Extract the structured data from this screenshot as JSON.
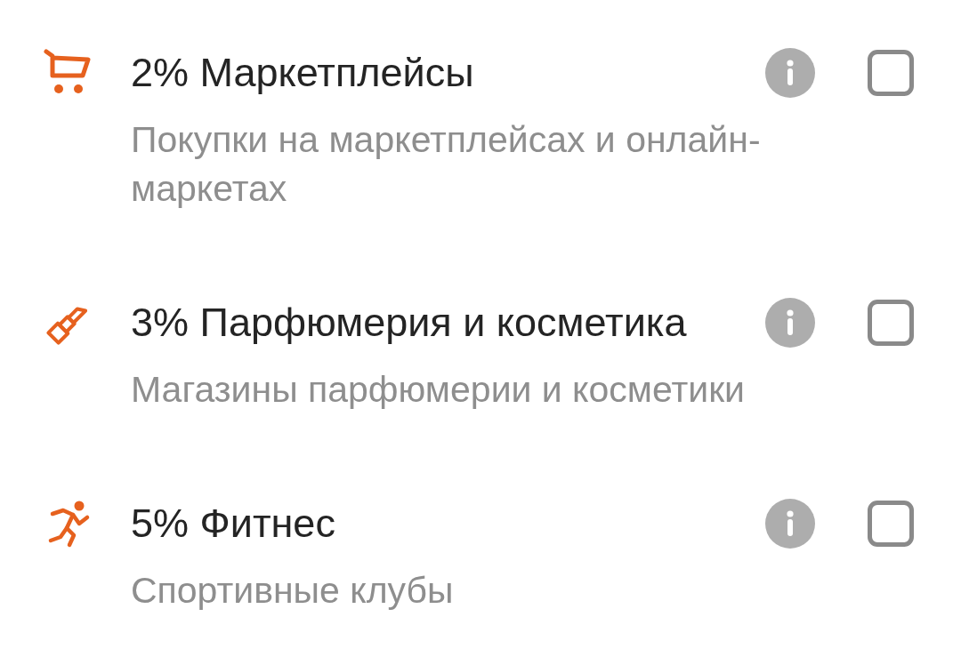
{
  "categories": [
    {
      "kind": "shopping",
      "title": "2% Маркетплейсы",
      "description": "Покупки на маркетплейсах и онлайн-маркетах",
      "checked": false
    },
    {
      "kind": "beauty",
      "title": "3% Парфюмерия и косметика",
      "description": "Магазины парфюмерии и косметики",
      "checked": false
    },
    {
      "kind": "fitness",
      "title": "5% Фитнес",
      "description": "Спортивные клубы",
      "checked": false
    }
  ]
}
